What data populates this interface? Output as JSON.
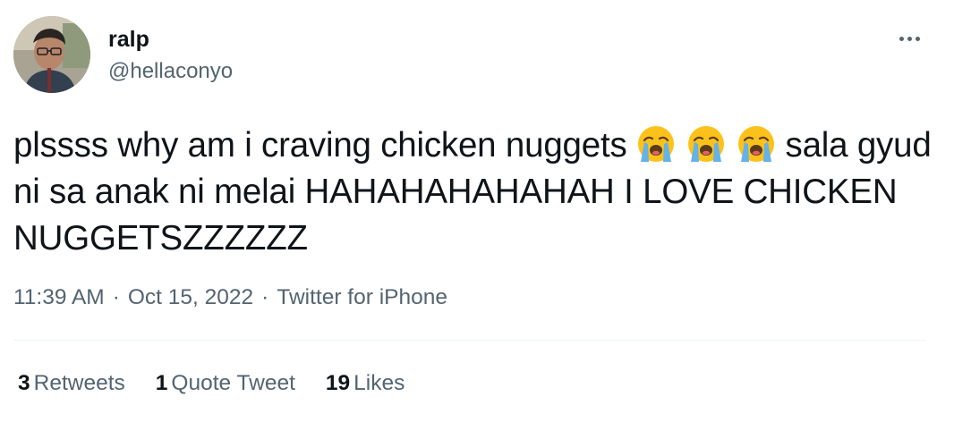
{
  "author": {
    "display_name": "ralp",
    "handle": "@hellaconyo"
  },
  "tweet": {
    "text_part1": "plssss why am i craving chicken nuggets",
    "emoji_names": [
      "loudly-crying-face-icon",
      "loudly-crying-face-icon",
      "loudly-crying-face-icon"
    ],
    "text_part2": "sala gyud ni sa anak ni melai HAHAHAHAHAHAH I LOVE CHICKEN NUGGETSZZZZZZ"
  },
  "meta": {
    "time": "11:39 AM",
    "separator": "·",
    "date": "Oct 15, 2022",
    "source": "Twitter for iPhone"
  },
  "stats": {
    "retweets_count": "3",
    "retweets_label": "Retweets",
    "quote_count": "1",
    "quote_label": "Quote Tweet",
    "likes_count": "19",
    "likes_label": "Likes"
  },
  "colors": {
    "text_primary": "#0f1419",
    "text_secondary": "#536471",
    "divider": "#eff3f4"
  }
}
